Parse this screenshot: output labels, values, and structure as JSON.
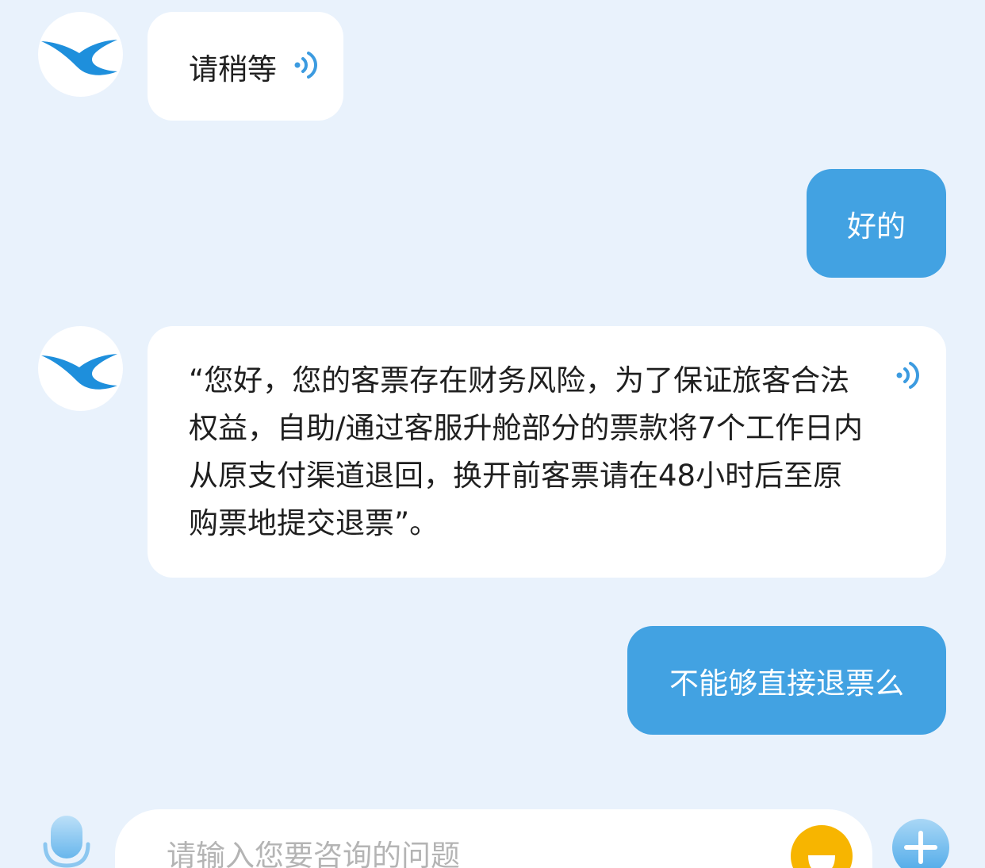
{
  "theme": {
    "background": "#E9F2FC",
    "bot_bubble": "#FFFFFF",
    "user_bubble": "#42A2E2",
    "accent": "#3C9BE0",
    "logo": "#1E8FDC",
    "emoji": "#F7B500"
  },
  "avatar": {
    "icon": "bird-logo-icon"
  },
  "messages": [
    {
      "bot": {
        "text": "请稍等",
        "icon": "speaker-icon"
      }
    },
    {
      "user": {
        "text": "好的"
      }
    },
    {
      "bot": {
        "lines": [
          "“您好，您的客票存在财务风险，为了保证旅客合法",
          "权益，自助/通过客服升舱部分的票款将7个工作日内",
          "从原支付渠道退回，换开前客票请在48小时后至原",
          "购票地提交退票”。"
        ],
        "icon": "speaker-icon"
      }
    },
    {
      "user": {
        "text": "不能够直接退票么"
      }
    }
  ],
  "input_bar": {
    "placeholder": "请输入您要咨询的问题",
    "left_icon": "microphone-icon",
    "emoji_icon": "smiley-icon",
    "right_icon": "plus-icon"
  }
}
